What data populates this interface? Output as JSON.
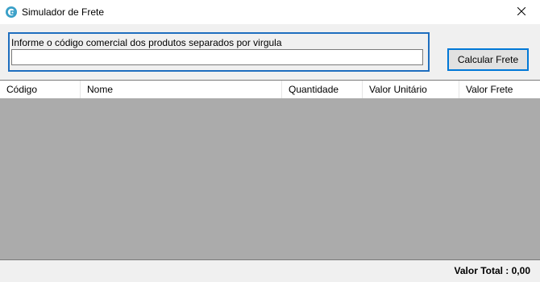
{
  "window": {
    "title": "Simulador de Frete",
    "icon": "app-logo-icon",
    "close_icon": "close-icon"
  },
  "form": {
    "group_label": "Informe o código comercial dos produtos separados por virgula",
    "input_value": "",
    "calculate_button": "Calcular Frete",
    "accent_color": "#1e6ebf"
  },
  "grid": {
    "columns": [
      "Código",
      "Nome",
      "Quantidade",
      "Valor Unitário",
      "Valor Frete"
    ],
    "rows": [],
    "empty_background": "#ababab"
  },
  "footer": {
    "total_label": "Valor Total : 0,00"
  }
}
